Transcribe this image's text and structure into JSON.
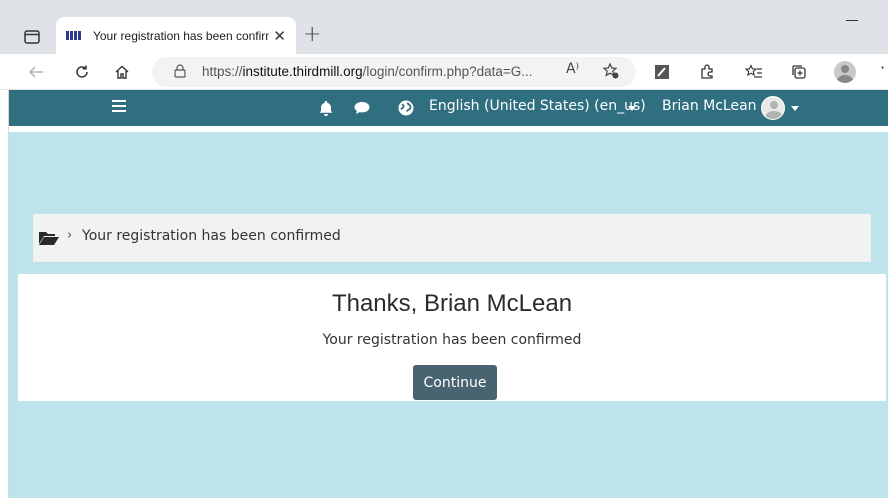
{
  "browser": {
    "tab_title": "Your registration has been confirmed",
    "tab_close": "✕",
    "new_tab": "+",
    "url_prefix": "https://",
    "url_domain": "institute.thirdmill.org",
    "url_path": "/login/confirm.php?data=G...",
    "read_aloud": "A⁾",
    "more": "·"
  },
  "site_nav": {
    "language": "English (United States) (en_us)",
    "user_name": "Brian McLean"
  },
  "breadcrumb": {
    "separator": "›",
    "current": "Your registration has been confirmed"
  },
  "card": {
    "title": "Thanks, Brian McLean",
    "message": "Your registration has been confirmed",
    "continue_label": "Continue"
  },
  "colors": {
    "nav_bg": "#2f6f80",
    "page_bg": "#bde4ea",
    "button_bg": "#486471"
  }
}
